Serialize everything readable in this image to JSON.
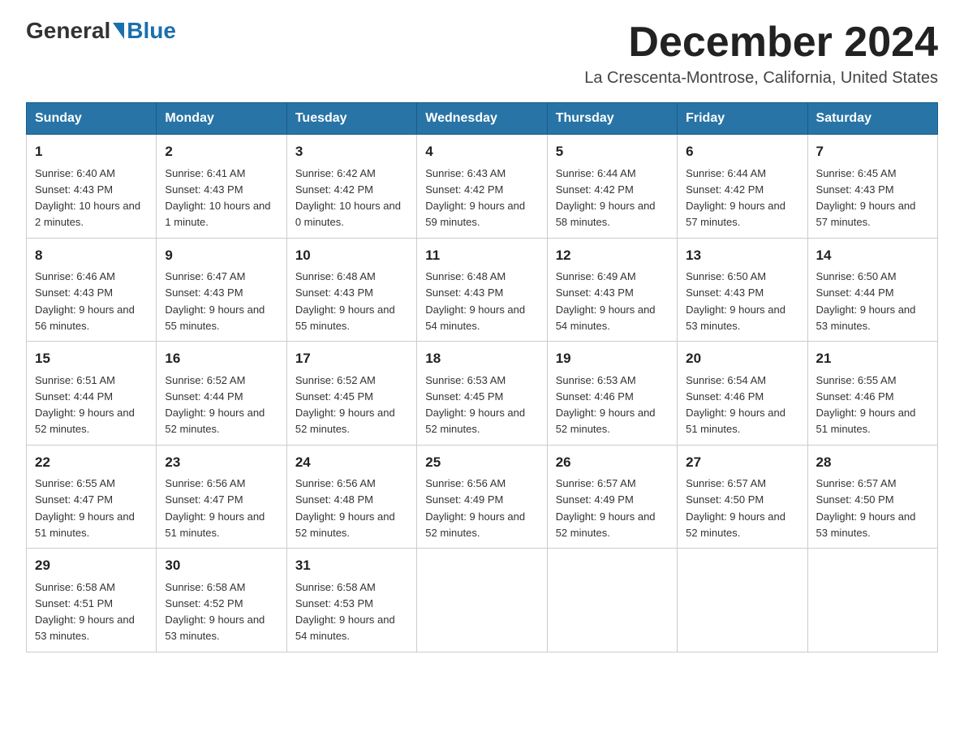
{
  "header": {
    "logo_general": "General",
    "logo_blue": "Blue",
    "month_title": "December 2024",
    "location": "La Crescenta-Montrose, California, United States"
  },
  "weekdays": [
    "Sunday",
    "Monday",
    "Tuesday",
    "Wednesday",
    "Thursday",
    "Friday",
    "Saturday"
  ],
  "weeks": [
    [
      {
        "day": "1",
        "sunrise": "6:40 AM",
        "sunset": "4:43 PM",
        "daylight": "10 hours and 2 minutes."
      },
      {
        "day": "2",
        "sunrise": "6:41 AM",
        "sunset": "4:43 PM",
        "daylight": "10 hours and 1 minute."
      },
      {
        "day": "3",
        "sunrise": "6:42 AM",
        "sunset": "4:42 PM",
        "daylight": "10 hours and 0 minutes."
      },
      {
        "day": "4",
        "sunrise": "6:43 AM",
        "sunset": "4:42 PM",
        "daylight": "9 hours and 59 minutes."
      },
      {
        "day": "5",
        "sunrise": "6:44 AM",
        "sunset": "4:42 PM",
        "daylight": "9 hours and 58 minutes."
      },
      {
        "day": "6",
        "sunrise": "6:44 AM",
        "sunset": "4:42 PM",
        "daylight": "9 hours and 57 minutes."
      },
      {
        "day": "7",
        "sunrise": "6:45 AM",
        "sunset": "4:43 PM",
        "daylight": "9 hours and 57 minutes."
      }
    ],
    [
      {
        "day": "8",
        "sunrise": "6:46 AM",
        "sunset": "4:43 PM",
        "daylight": "9 hours and 56 minutes."
      },
      {
        "day": "9",
        "sunrise": "6:47 AM",
        "sunset": "4:43 PM",
        "daylight": "9 hours and 55 minutes."
      },
      {
        "day": "10",
        "sunrise": "6:48 AM",
        "sunset": "4:43 PM",
        "daylight": "9 hours and 55 minutes."
      },
      {
        "day": "11",
        "sunrise": "6:48 AM",
        "sunset": "4:43 PM",
        "daylight": "9 hours and 54 minutes."
      },
      {
        "day": "12",
        "sunrise": "6:49 AM",
        "sunset": "4:43 PM",
        "daylight": "9 hours and 54 minutes."
      },
      {
        "day": "13",
        "sunrise": "6:50 AM",
        "sunset": "4:43 PM",
        "daylight": "9 hours and 53 minutes."
      },
      {
        "day": "14",
        "sunrise": "6:50 AM",
        "sunset": "4:44 PM",
        "daylight": "9 hours and 53 minutes."
      }
    ],
    [
      {
        "day": "15",
        "sunrise": "6:51 AM",
        "sunset": "4:44 PM",
        "daylight": "9 hours and 52 minutes."
      },
      {
        "day": "16",
        "sunrise": "6:52 AM",
        "sunset": "4:44 PM",
        "daylight": "9 hours and 52 minutes."
      },
      {
        "day": "17",
        "sunrise": "6:52 AM",
        "sunset": "4:45 PM",
        "daylight": "9 hours and 52 minutes."
      },
      {
        "day": "18",
        "sunrise": "6:53 AM",
        "sunset": "4:45 PM",
        "daylight": "9 hours and 52 minutes."
      },
      {
        "day": "19",
        "sunrise": "6:53 AM",
        "sunset": "4:46 PM",
        "daylight": "9 hours and 52 minutes."
      },
      {
        "day": "20",
        "sunrise": "6:54 AM",
        "sunset": "4:46 PM",
        "daylight": "9 hours and 51 minutes."
      },
      {
        "day": "21",
        "sunrise": "6:55 AM",
        "sunset": "4:46 PM",
        "daylight": "9 hours and 51 minutes."
      }
    ],
    [
      {
        "day": "22",
        "sunrise": "6:55 AM",
        "sunset": "4:47 PM",
        "daylight": "9 hours and 51 minutes."
      },
      {
        "day": "23",
        "sunrise": "6:56 AM",
        "sunset": "4:47 PM",
        "daylight": "9 hours and 51 minutes."
      },
      {
        "day": "24",
        "sunrise": "6:56 AM",
        "sunset": "4:48 PM",
        "daylight": "9 hours and 52 minutes."
      },
      {
        "day": "25",
        "sunrise": "6:56 AM",
        "sunset": "4:49 PM",
        "daylight": "9 hours and 52 minutes."
      },
      {
        "day": "26",
        "sunrise": "6:57 AM",
        "sunset": "4:49 PM",
        "daylight": "9 hours and 52 minutes."
      },
      {
        "day": "27",
        "sunrise": "6:57 AM",
        "sunset": "4:50 PM",
        "daylight": "9 hours and 52 minutes."
      },
      {
        "day": "28",
        "sunrise": "6:57 AM",
        "sunset": "4:50 PM",
        "daylight": "9 hours and 53 minutes."
      }
    ],
    [
      {
        "day": "29",
        "sunrise": "6:58 AM",
        "sunset": "4:51 PM",
        "daylight": "9 hours and 53 minutes."
      },
      {
        "day": "30",
        "sunrise": "6:58 AM",
        "sunset": "4:52 PM",
        "daylight": "9 hours and 53 minutes."
      },
      {
        "day": "31",
        "sunrise": "6:58 AM",
        "sunset": "4:53 PM",
        "daylight": "9 hours and 54 minutes."
      },
      null,
      null,
      null,
      null
    ]
  ],
  "labels": {
    "sunrise": "Sunrise:",
    "sunset": "Sunset:",
    "daylight": "Daylight:"
  }
}
